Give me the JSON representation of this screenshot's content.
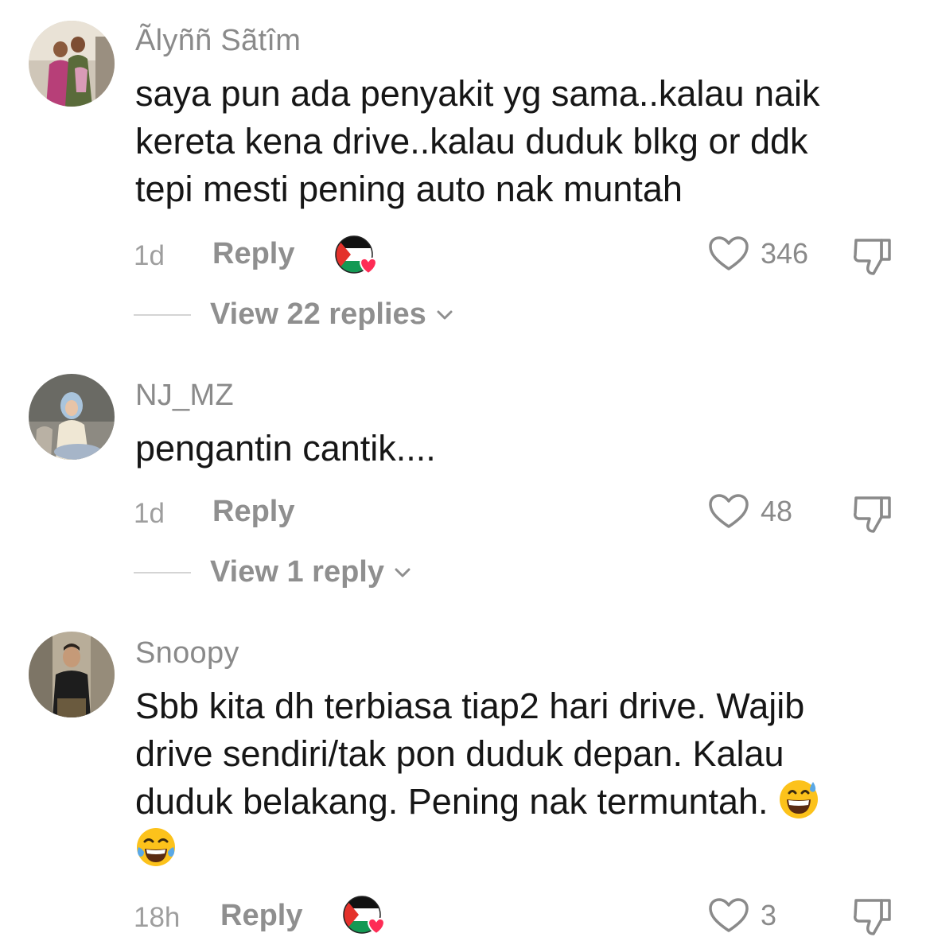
{
  "comments": [
    {
      "username": "Ãlyññ Sãtîm",
      "text_lines": [
        "saya pun ada penyakit yg sama..kalau naik",
        "kereta kena drive..kalau duduk blkg or ddk",
        "tepi mesti pening auto nak muntah"
      ],
      "time": "1d",
      "reply_label": "Reply",
      "creator_liked": true,
      "likes": "346",
      "view_replies": "View 22 replies"
    },
    {
      "username": "NJ_MZ",
      "text_lines": [
        "pengantin cantik...."
      ],
      "time": "1d",
      "reply_label": "Reply",
      "creator_liked": false,
      "likes": "48",
      "view_replies": "View 1 reply"
    },
    {
      "username": "Snoopy",
      "text_lines": [
        "Sbb kita dh terbiasa tiap2 hari drive. Wajib",
        "drive sendiri/tak pon duduk depan. Kalau",
        "duduk belakang. Pening nak termuntah."
      ],
      "emojis": [
        "grinning-sweat",
        "tears-of-joy"
      ],
      "time": "18h",
      "reply_label": "Reply",
      "creator_liked": true,
      "likes": "3"
    }
  ],
  "icons": {
    "like": "heart-outline-icon",
    "dislike": "thumbs-down-icon",
    "expand": "chevron-down-icon",
    "creator_badge": "creator-liked-badge"
  },
  "colors": {
    "text": "#161616",
    "muted": "#8a8a8a",
    "heart_badge": "#fe2c55",
    "flag_red": "#e4312b",
    "flag_green": "#149954"
  }
}
